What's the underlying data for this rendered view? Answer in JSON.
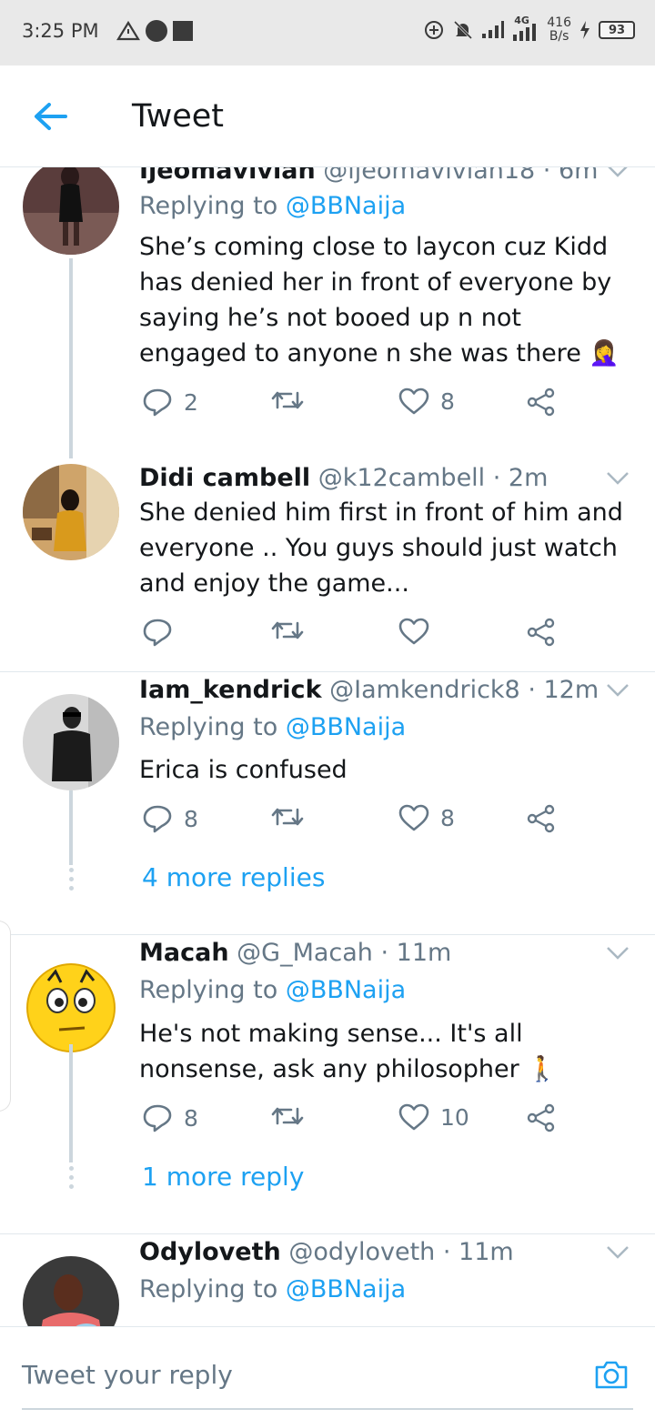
{
  "status_bar": {
    "time": "3:25 PM",
    "network": "4G",
    "speed_value": "416",
    "speed_unit": "B/s",
    "battery": "93"
  },
  "header": {
    "title": "Tweet"
  },
  "colors": {
    "accent": "#1da1f2",
    "secondary_text": "#657786",
    "thread_line": "#ccd6dd"
  },
  "tweets": [
    {
      "name": "Ijeomavivian",
      "handle": "@ijeomavivian18 · 6m",
      "replying_label": "Replying to",
      "replying_to": "@BBNaija",
      "text": "She’s coming close to laycon cuz Kidd has denied her in front of everyone by saying he’s not booed up n not engaged to anyone n she was there 🤦‍♀️",
      "reply_count": "2",
      "retweet_count": "",
      "like_count": "8"
    },
    {
      "name": "Didi cambell",
      "handle": "@k12cambell · 2m",
      "text": "She denied him first in front of him and everyone .. You guys should just watch and enjoy the game...",
      "reply_count": "",
      "retweet_count": "",
      "like_count": ""
    },
    {
      "name": "Iam_kendrick",
      "handle": "@Iamkendrick8 · 12m",
      "replying_label": "Replying to",
      "replying_to": "@BBNaija",
      "text": "Erica is confused",
      "reply_count": "8",
      "retweet_count": "",
      "like_count": "8",
      "more_replies": "4 more replies"
    },
    {
      "name": "Macah",
      "handle": "@G_Macah · 11m",
      "replying_label": "Replying to",
      "replying_to": "@BBNaija",
      "text": "He's not making sense... It's all nonsense, ask any philosopher 🚶",
      "reply_count": "8",
      "retweet_count": "",
      "like_count": "10",
      "more_replies": "1 more reply"
    },
    {
      "name": "Odyloveth",
      "handle": "@odyloveth · 11m",
      "replying_label": "Replying to",
      "replying_to": "@BBNaija"
    }
  ],
  "reply_bar": {
    "placeholder": "Tweet your reply"
  }
}
